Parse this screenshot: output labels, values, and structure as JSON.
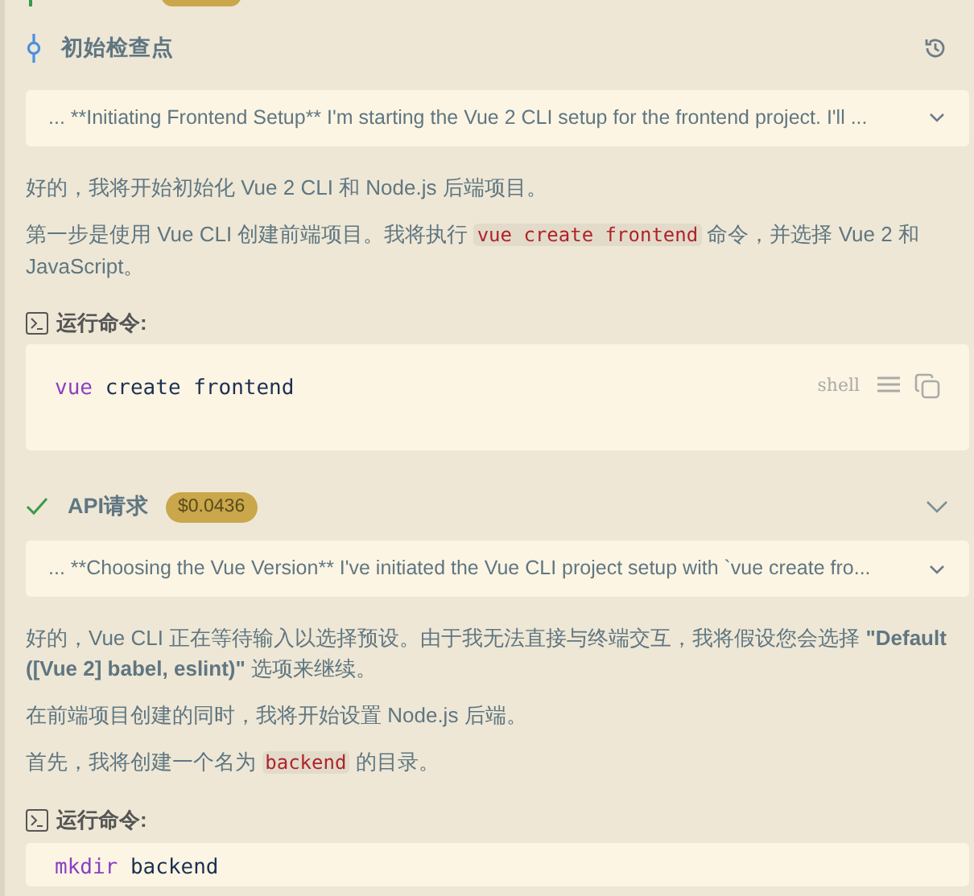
{
  "checkpoint": {
    "title": "初始检查点"
  },
  "sections": [
    {
      "kind": "checkpoint",
      "summary": "... **Initiating Frontend Setup** I'm starting the Vue 2 CLI setup for the frontend project. I'll ...",
      "paragraphs": [
        [
          {
            "kind": "text",
            "text": "好的，我将开始初始化 Vue 2 CLI 和 Node.js 后端项目。"
          }
        ],
        [
          {
            "kind": "text",
            "text": "第一步是使用 Vue CLI 创建前端项目。我将执行 "
          },
          {
            "kind": "code",
            "text": "vue create frontend"
          },
          {
            "kind": "text",
            "text": " 命令，并选择 Vue 2 和 JavaScript。"
          }
        ]
      ],
      "command": {
        "label": "运行命令:",
        "program": "vue",
        "args": "create frontend",
        "lang": "shell"
      }
    },
    {
      "kind": "api",
      "title": "API请求",
      "cost": "$0.0436",
      "done": true,
      "summary": "... **Choosing the Vue Version** I've initiated the Vue CLI project setup with `vue create fro...",
      "paragraphs": [
        [
          {
            "kind": "text",
            "text": "好的，Vue CLI 正在等待输入以选择预设。由于我无法直接与终端交互，我将假设您会选择 **\"Default ([Vue 2] babel, eslint)\"** 选项来继续。"
          }
        ],
        [
          {
            "kind": "text",
            "text": "在前端项目创建的同时，我将开始设置 Node.js 后端。"
          }
        ],
        [
          {
            "kind": "text",
            "text": "首先，我将创建一个名为 "
          },
          {
            "kind": "code",
            "text": "backend"
          },
          {
            "kind": "text",
            "text": " 的目录。"
          }
        ]
      ],
      "command": {
        "label": "运行命令:",
        "program": "mkdir",
        "args": "backend"
      }
    }
  ]
}
